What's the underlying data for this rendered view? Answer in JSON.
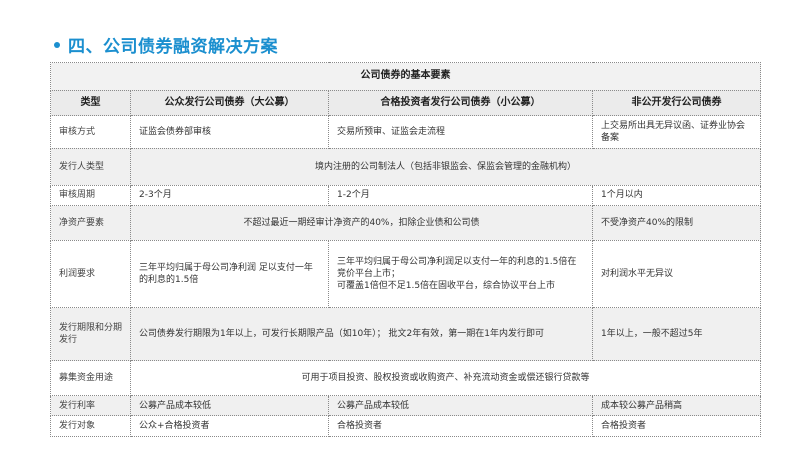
{
  "title": "四、公司债券融资解决方案",
  "table": {
    "caption": "公司债券的基本要素",
    "headers": [
      "类型",
      "公众发行公司债券（大公募）",
      "合格投资者发行公司债券（小公募）",
      "非公开发行公司债券"
    ],
    "rows": [
      {
        "label": "审核方式",
        "c1": "证监会债券部审核",
        "c2": "交易所预审、证监会走流程",
        "c3": "上交易所出具无异议函、证券业协会备案"
      },
      {
        "label": "发行人类型",
        "merged": "境内注册的公司制法人（包括非银监会、保监会管理的金融机构）"
      },
      {
        "label": "审核周期",
        "c1": "2-3个月",
        "c2": "1-2个月",
        "c3": "1个月以内"
      },
      {
        "label": "净资产要素",
        "c12": "不超过最近一期经审计净资产的40%，扣除企业债和公司债",
        "c3": "不受净资产40%的限制"
      },
      {
        "label": "利润要求",
        "c1": "三年平均归属于母公司净利润 足以支付一年的利息的1.5倍",
        "c2": "三年平均归属于母公司净利润足以支付一年的利息的1.5倍在竞价平台上市；\n可覆盖1倍但不足1.5倍在固收平台，综合协议平台上市",
        "c3": "对利润水平无异议"
      },
      {
        "label": "发行期限和分期发行",
        "c12": "公司债券发行期限为1年以上，可发行长期限产品（如10年）； 批文2年有效，第一期在1年内发行即可",
        "c3": "1年以上，一般不超过5年"
      },
      {
        "label": "募集资金用途",
        "merged": "可用于项目投资、股权投资或收购资产、补充流动资金或偿还银行贷款等"
      },
      {
        "label": "发行利率",
        "c1": "公募产品成本较低",
        "c2": "公募产品成本较低",
        "c3": "成本较公募产品稍高"
      },
      {
        "label": "发行对象",
        "c1": "公众+合格投资者",
        "c2": "合格投资者",
        "c3": "合格投资者"
      }
    ]
  }
}
